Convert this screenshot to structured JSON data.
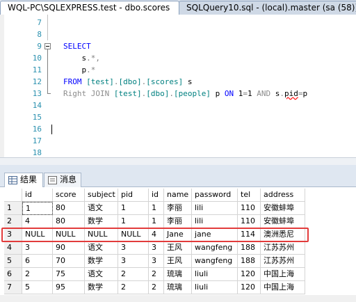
{
  "tabs": [
    {
      "label": "WQL-PC\\SQLEXPRESS.test - dbo.scores"
    },
    {
      "label": "SQLQuery10.sql - (local).master (sa (58))"
    }
  ],
  "editor": {
    "lines": [
      {
        "num": "7"
      },
      {
        "num": "8"
      },
      {
        "num": "9",
        "tokens": [
          {
            "t": "SELECT",
            "c": "kw"
          }
        ]
      },
      {
        "num": "10",
        "tokens": [
          {
            "t": "    s",
            "c": ""
          },
          {
            "t": ".",
            "c": "gray"
          },
          {
            "t": "*",
            "c": "gray"
          },
          {
            "t": ",",
            "c": "gray"
          }
        ]
      },
      {
        "num": "11",
        "tokens": [
          {
            "t": "    p",
            "c": ""
          },
          {
            "t": ".",
            "c": "gray"
          },
          {
            "t": "*",
            "c": "gray"
          }
        ]
      },
      {
        "num": "12",
        "tokens": [
          {
            "t": "FROM",
            "c": "kw"
          },
          {
            "t": " [test]",
            "c": "tbl"
          },
          {
            "t": ".",
            "c": "gray"
          },
          {
            "t": "[dbo]",
            "c": "tbl"
          },
          {
            "t": ".",
            "c": "gray"
          },
          {
            "t": "[scores]",
            "c": "tbl"
          },
          {
            "t": " s",
            "c": ""
          }
        ]
      },
      {
        "num": "13",
        "tokens": [
          {
            "t": "Right JOIN",
            "c": "fade"
          },
          {
            "t": " [test]",
            "c": "tbl"
          },
          {
            "t": ".",
            "c": "gray"
          },
          {
            "t": "[dbo]",
            "c": "tbl"
          },
          {
            "t": ".",
            "c": "gray"
          },
          {
            "t": "[people]",
            "c": "tbl"
          },
          {
            "t": " p ",
            "c": ""
          },
          {
            "t": "ON",
            "c": "kw"
          },
          {
            "t": " 1",
            "c": ""
          },
          {
            "t": "=",
            "c": "gray"
          },
          {
            "t": "1 ",
            "c": ""
          },
          {
            "t": "AND",
            "c": "fade"
          },
          {
            "t": " s",
            "c": ""
          },
          {
            "t": ".",
            "c": "gray"
          },
          {
            "t": "pid",
            "c": "squiggle"
          },
          {
            "t": "=",
            "c": "gray"
          },
          {
            "t": "p",
            "c": ""
          }
        ]
      },
      {
        "num": "14"
      },
      {
        "num": "15"
      },
      {
        "num": "16"
      },
      {
        "num": "17"
      },
      {
        "num": "18"
      }
    ]
  },
  "results": {
    "tabs": [
      {
        "label": "结果"
      },
      {
        "label": "消息"
      }
    ],
    "columns": [
      "",
      "id",
      "score",
      "subject",
      "pid",
      "id",
      "name",
      "password",
      "tel",
      "address"
    ],
    "rows": [
      [
        "1",
        "1",
        "80",
        "语文",
        "1",
        "1",
        "李丽",
        "lili",
        "110",
        "安徽蚌埠"
      ],
      [
        "2",
        "4",
        "80",
        "数学",
        "1",
        "1",
        "李丽",
        "lili",
        "110",
        "安徽蚌埠"
      ],
      [
        "3",
        "NULL",
        "NULL",
        "NULL",
        "NULL",
        "4",
        "Jane",
        "jane",
        "114",
        "澳洲悉尼"
      ],
      [
        "4",
        "3",
        "90",
        "语文",
        "3",
        "3",
        "王风",
        "wangfeng",
        "188",
        "江苏苏州"
      ],
      [
        "5",
        "6",
        "70",
        "数学",
        "3",
        "3",
        "王风",
        "wangfeng",
        "188",
        "江苏苏州"
      ],
      [
        "6",
        "2",
        "75",
        "语文",
        "2",
        "2",
        "琉璃",
        "liuli",
        "120",
        "中国上海"
      ],
      [
        "7",
        "5",
        "95",
        "数学",
        "2",
        "2",
        "琉璃",
        "liuli",
        "120",
        "中国上海"
      ]
    ],
    "highlighted_row": 3,
    "colors": {
      "highlight": "#e23b3b",
      "null_row_bg": "#fffbe0"
    }
  }
}
